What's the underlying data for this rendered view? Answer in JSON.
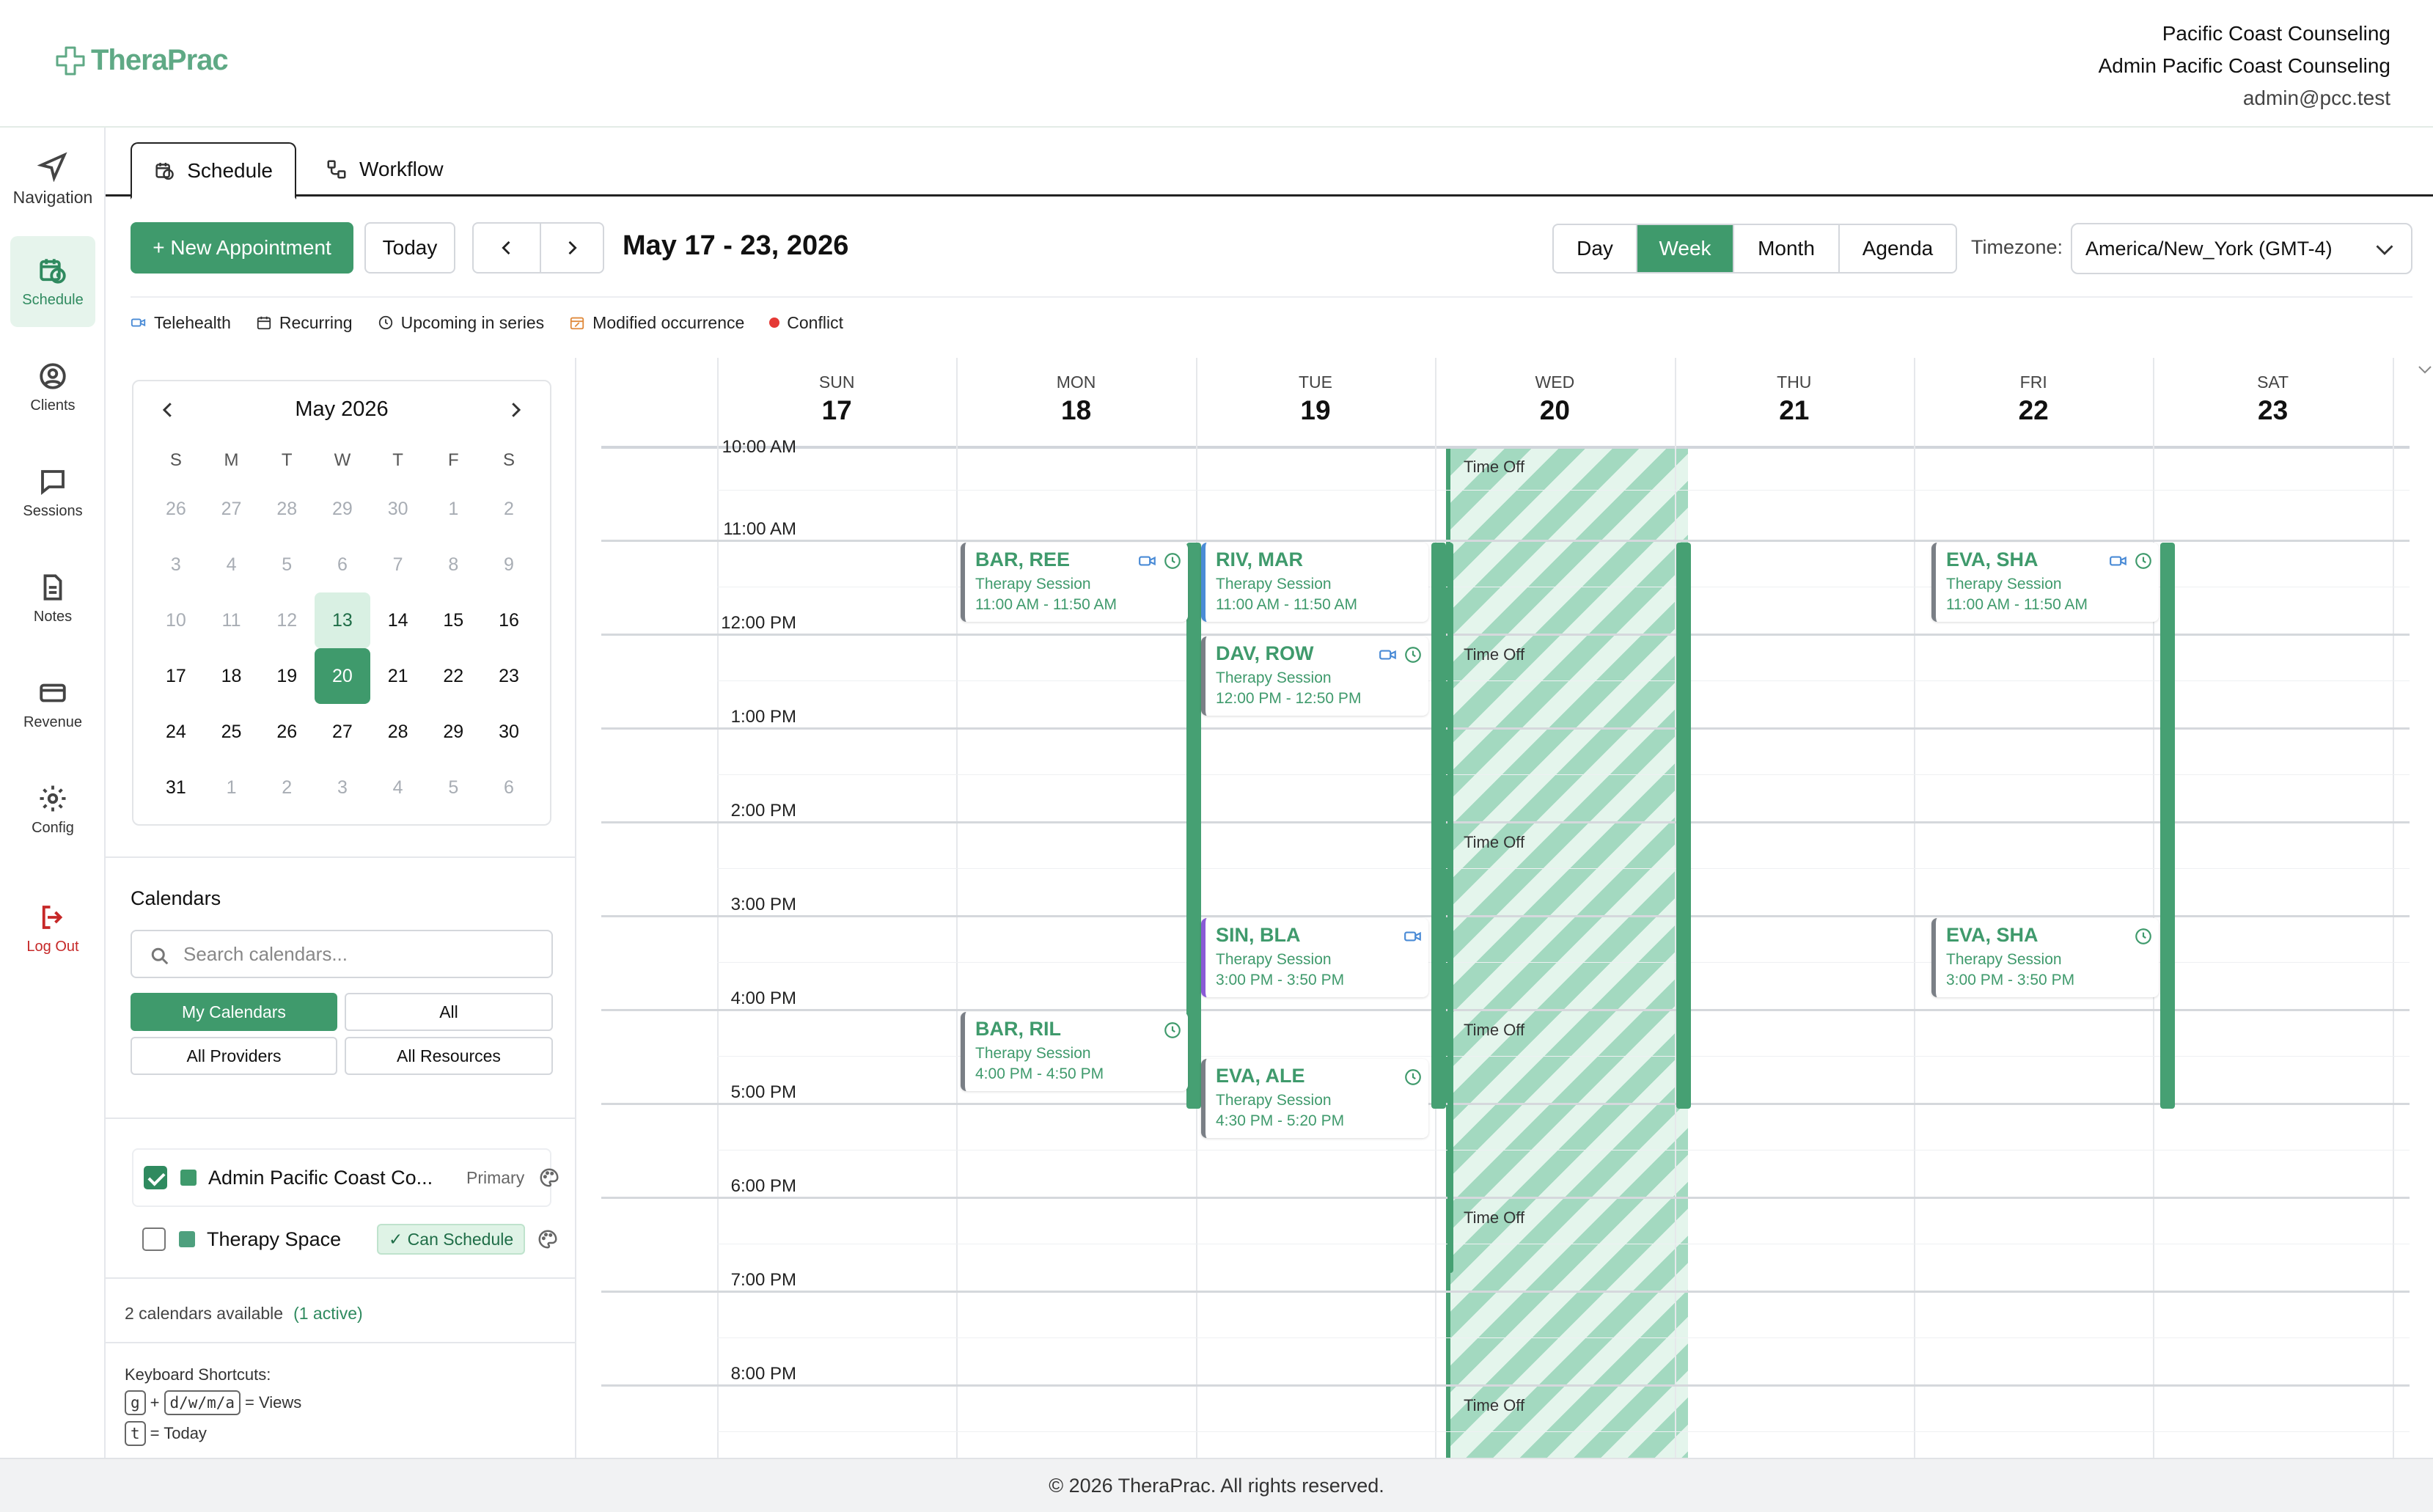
{
  "brand": {
    "name": "TheraPrac",
    "accent": "#3f9a6c"
  },
  "header": {
    "org": "Pacific Coast Counseling",
    "user": "Admin Pacific Coast Counseling",
    "email": "admin@pcc.test"
  },
  "nav": [
    {
      "label": "Navigation",
      "icon": "navigation-arrow-icon"
    },
    {
      "label": "Schedule",
      "icon": "calendar-clock-icon",
      "active": true
    },
    {
      "label": "Clients",
      "icon": "user-circle-icon"
    },
    {
      "label": "Sessions",
      "icon": "chat-bubble-icon"
    },
    {
      "label": "Notes",
      "icon": "document-icon"
    },
    {
      "label": "Revenue",
      "icon": "credit-card-icon"
    },
    {
      "label": "Config",
      "icon": "gear-icon"
    },
    {
      "label": "Log Out",
      "icon": "logout-icon"
    }
  ],
  "tabs": [
    {
      "label": "Schedule",
      "active": true
    },
    {
      "label": "Workflow"
    }
  ],
  "toolbar": {
    "new_appt": "+ New Appointment",
    "today": "Today",
    "range": "May 17 - 23, 2026",
    "views": [
      "Day",
      "Week",
      "Month",
      "Agenda"
    ],
    "active_view": "Week",
    "tz_label": "Timezone:",
    "tz_value": "America/New_York (GMT-4)"
  },
  "legend": [
    {
      "label": "Telehealth",
      "icon": "video-icon"
    },
    {
      "label": "Recurring",
      "icon": "recurring-calendar-icon"
    },
    {
      "label": "Upcoming in series",
      "icon": "clock-icon"
    },
    {
      "label": "Modified occurrence",
      "icon": "modified-calendar-icon"
    },
    {
      "label": "Conflict",
      "icon": "red-dot-icon"
    }
  ],
  "mini_calendar": {
    "title": "May 2026",
    "weekdays": [
      "S",
      "M",
      "T",
      "W",
      "T",
      "F",
      "S"
    ],
    "weeks": [
      [
        {
          "d": "26",
          "dim": true
        },
        {
          "d": "27",
          "dim": true
        },
        {
          "d": "28",
          "dim": true
        },
        {
          "d": "29",
          "dim": true
        },
        {
          "d": "30",
          "dim": true
        },
        {
          "d": "1",
          "dim": true
        },
        {
          "d": "2",
          "dim": true
        }
      ],
      [
        {
          "d": "3",
          "dim": true
        },
        {
          "d": "4",
          "dim": true
        },
        {
          "d": "5",
          "dim": true
        },
        {
          "d": "6",
          "dim": true
        },
        {
          "d": "7",
          "dim": true
        },
        {
          "d": "8",
          "dim": true
        },
        {
          "d": "9",
          "dim": true
        }
      ],
      [
        {
          "d": "10",
          "dim": true
        },
        {
          "d": "11",
          "dim": true
        },
        {
          "d": "12",
          "dim": true
        },
        {
          "d": "13",
          "today": true
        },
        {
          "d": "14"
        },
        {
          "d": "15"
        },
        {
          "d": "16"
        }
      ],
      [
        {
          "d": "17"
        },
        {
          "d": "18"
        },
        {
          "d": "19"
        },
        {
          "d": "20",
          "selected": true
        },
        {
          "d": "21"
        },
        {
          "d": "22"
        },
        {
          "d": "23"
        }
      ],
      [
        {
          "d": "24"
        },
        {
          "d": "25"
        },
        {
          "d": "26"
        },
        {
          "d": "27"
        },
        {
          "d": "28"
        },
        {
          "d": "29"
        },
        {
          "d": "30"
        }
      ],
      [
        {
          "d": "31"
        },
        {
          "d": "1",
          "dim": true
        },
        {
          "d": "2",
          "dim": true
        },
        {
          "d": "3",
          "dim": true
        },
        {
          "d": "4",
          "dim": true
        },
        {
          "d": "5",
          "dim": true
        },
        {
          "d": "6",
          "dim": true
        }
      ]
    ]
  },
  "calendars": {
    "heading": "Calendars",
    "search_placeholder": "Search calendars...",
    "filters": [
      "My Calendars",
      "All",
      "All Providers",
      "All Resources"
    ],
    "items": [
      {
        "name": "Admin Pacific Coast Co...",
        "tag": "Primary",
        "checked": true
      },
      {
        "name": "Therapy Space",
        "tag": "✓ Can Schedule",
        "checked": false
      }
    ],
    "count": "2 calendars available",
    "active": "(1 active)"
  },
  "shortcuts": {
    "title": "Keyboard Shortcuts:",
    "g_key": "g",
    "plus": "+",
    "views_keys": "d/w/m/a",
    "views_label": "= Views",
    "t_key": "t",
    "today_label": "= Today"
  },
  "week": {
    "days": [
      {
        "name": "SUN",
        "num": "17"
      },
      {
        "name": "MON",
        "num": "18"
      },
      {
        "name": "TUE",
        "num": "19"
      },
      {
        "name": "WED",
        "num": "20"
      },
      {
        "name": "THU",
        "num": "21"
      },
      {
        "name": "FRI",
        "num": "22"
      },
      {
        "name": "SAT",
        "num": "23"
      }
    ],
    "times": [
      "10:00 AM",
      "11:00 AM",
      "12:00 PM",
      "1:00 PM",
      "2:00 PM",
      "3:00 PM",
      "4:00 PM",
      "5:00 PM",
      "6:00 PM",
      "7:00 PM",
      "8:00 PM"
    ],
    "time_off_label": "Time Off",
    "appointments": [
      {
        "name": "BAR, REE",
        "type": "Therapy Session",
        "time": "11:00 AM - 11:50 AM",
        "icons": [
          "video-icon",
          "clock-icon"
        ]
      },
      {
        "name": "RIV, MAR",
        "type": "Therapy Session",
        "time": "11:00 AM - 11:50 AM",
        "icons": []
      },
      {
        "name": "DAV, ROW",
        "type": "Therapy Session",
        "time": "12:00 PM - 12:50 PM",
        "icons": [
          "video-icon",
          "clock-icon"
        ]
      },
      {
        "name": "EVA, SHA",
        "type": "Therapy Session",
        "time": "11:00 AM - 11:50 AM",
        "icons": [
          "video-icon",
          "clock-icon"
        ]
      },
      {
        "name": "SIN, BLA",
        "type": "Therapy Session",
        "time": "3:00 PM - 3:50 PM",
        "icons": [
          "video-icon"
        ]
      },
      {
        "name": "EVA, SHA",
        "type": "Therapy Session",
        "time": "3:00 PM - 3:50 PM",
        "icons": [
          "clock-icon"
        ]
      },
      {
        "name": "BAR, RIL",
        "type": "Therapy Session",
        "time": "4:00 PM - 4:50 PM",
        "icons": [
          "clock-icon"
        ]
      },
      {
        "name": "EVA, ALE",
        "type": "Therapy Session",
        "time": "4:30 PM - 5:20 PM",
        "icons": [
          "clock-icon"
        ]
      }
    ]
  },
  "footer": "© 2026 TheraPrac. All rights reserved."
}
